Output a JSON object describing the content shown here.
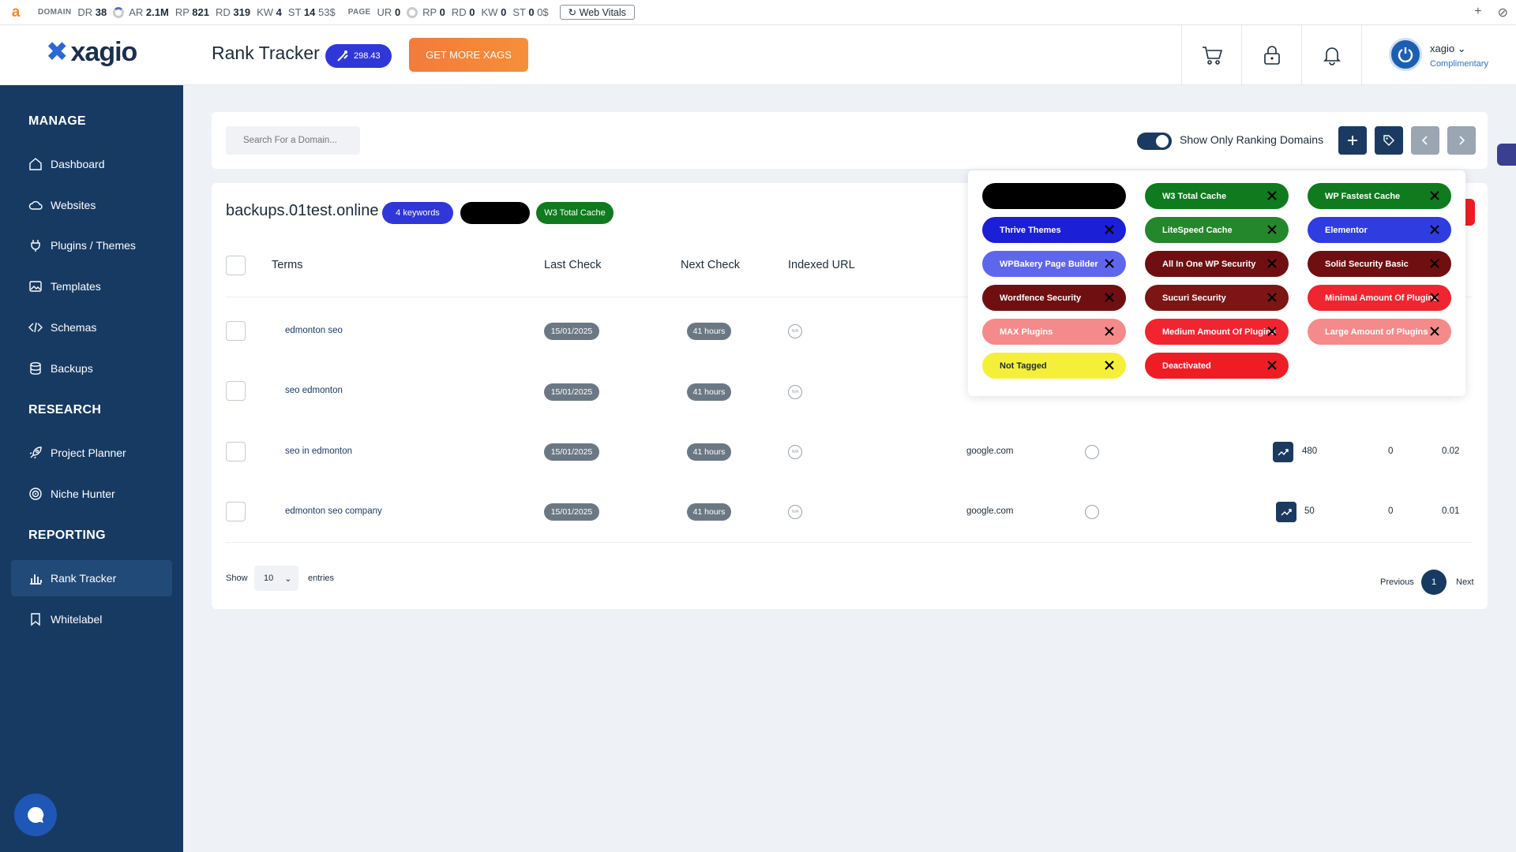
{
  "seo_bar": {
    "logo": "a",
    "domain_label": "DOMAIN",
    "domain_metrics": [
      {
        "k": "DR",
        "v": "38"
      },
      {
        "k": "AR",
        "v": "2.1M"
      },
      {
        "k": "RP",
        "v": "821"
      },
      {
        "k": "RD",
        "v": "319"
      },
      {
        "k": "KW",
        "v": "4"
      },
      {
        "k": "ST",
        "v": "14"
      }
    ],
    "domain_st_cost": "53$",
    "page_label": "PAGE",
    "page_metrics": [
      {
        "k": "UR",
        "v": "0"
      },
      {
        "k": "RP",
        "v": "0"
      },
      {
        "k": "RD",
        "v": "0"
      },
      {
        "k": "KW",
        "v": "0"
      },
      {
        "k": "ST",
        "v": "0"
      }
    ],
    "page_st_cost": "0$",
    "web_vitals": "Web Vitals"
  },
  "header": {
    "logo_text": "xagio",
    "title": "Rank Tracker",
    "xags_value": "298.43",
    "get_more": "GET MORE XAGS",
    "user_name": "xagio",
    "user_plan": "Complimentary"
  },
  "sidebar": {
    "sections": [
      "MANAGE",
      "RESEARCH",
      "REPORTING"
    ],
    "items": [
      {
        "label": "Dashboard",
        "icon": "home-icon"
      },
      {
        "label": "Websites",
        "icon": "cloud-icon"
      },
      {
        "label": "Plugins / Themes",
        "icon": "plug-icon"
      },
      {
        "label": "Templates",
        "icon": "image-icon"
      },
      {
        "label": "Schemas",
        "icon": "code-icon"
      },
      {
        "label": "Backups",
        "icon": "database-icon"
      },
      {
        "label": "Project Planner",
        "icon": "rocket-icon"
      },
      {
        "label": "Niche Hunter",
        "icon": "target-icon"
      },
      {
        "label": "Rank Tracker",
        "icon": "bar-chart-icon",
        "active": true
      },
      {
        "label": "Whitelabel",
        "icon": "bookmark-icon"
      }
    ]
  },
  "search": {
    "placeholder": "Search For a Domain...",
    "toggle_label": "Show Only Ranking Domains",
    "toggle_on": true
  },
  "domain": {
    "name": "backups.01test.online",
    "keywords_badge": "4 keywords",
    "tag_badge": "W3 Total Cache"
  },
  "table": {
    "headers": [
      "Terms",
      "Last Check",
      "Next Check",
      "Indexed URL"
    ],
    "rows": [
      {
        "term": "edmonton seo",
        "last_check": "15/01/2025",
        "next_check": "41 hours",
        "indexed": "N/A",
        "engine": "",
        "volume": "",
        "col_a": "",
        "col_b": ""
      },
      {
        "term": "seo edmonton",
        "last_check": "15/01/2025",
        "next_check": "41 hours",
        "indexed": "N/A",
        "engine": "",
        "volume": "",
        "col_a": "",
        "col_b": ""
      },
      {
        "term": "seo in edmonton",
        "last_check": "15/01/2025",
        "next_check": "41 hours",
        "indexed": "N/A",
        "engine": "google.com",
        "volume": "480",
        "col_a": "0",
        "col_b": "0.02"
      },
      {
        "term": "edmonton seo company",
        "last_check": "15/01/2025",
        "next_check": "41 hours",
        "indexed": "N/A",
        "engine": "google.com",
        "volume": "50",
        "col_a": "0",
        "col_b": "0.01"
      }
    ],
    "show_label": "Show",
    "entries_value": "10",
    "entries_label": "entries",
    "prev": "Previous",
    "page": "1",
    "next": "Next"
  },
  "tags": [
    {
      "label": "",
      "color": "#000000",
      "removable": false
    },
    {
      "label": "W3 Total Cache",
      "color": "#0f7a1e",
      "removable": true
    },
    {
      "label": "WP Fastest Cache",
      "color": "#0f7a1e",
      "removable": true
    },
    {
      "label": "Thrive Themes",
      "color": "#1b1fd6",
      "removable": true
    },
    {
      "label": "LiteSpeed Cache",
      "color": "#24872c",
      "removable": true
    },
    {
      "label": "Elementor",
      "color": "#2e3ce0",
      "removable": true
    },
    {
      "label": "WPBakery Page Builder",
      "color": "#5f66ee",
      "removable": true
    },
    {
      "label": "All In One WP Security",
      "color": "#6f0f12",
      "removable": true
    },
    {
      "label": "Solid Security Basic",
      "color": "#6f0f12",
      "removable": true
    },
    {
      "label": "Wordfence Security",
      "color": "#6f0f12",
      "removable": true
    },
    {
      "label": "Sucuri Security",
      "color": "#7d1515",
      "removable": true
    },
    {
      "label": "Minimal Amount Of Plugins",
      "color": "#f0252f",
      "removable": true
    },
    {
      "label": "MAX Plugins",
      "color": "#f58a8a",
      "removable": true
    },
    {
      "label": "Medium Amount Of Plugins",
      "color": "#f0252f",
      "removable": true
    },
    {
      "label": "Large Amount of Plugins",
      "color": "#f58a8a",
      "removable": true
    },
    {
      "label": "Not Tagged",
      "color": "#f5ef3a",
      "removable": true,
      "dark_text": true
    },
    {
      "label": "Deactivated",
      "color": "#ee1d23",
      "removable": true
    }
  ]
}
